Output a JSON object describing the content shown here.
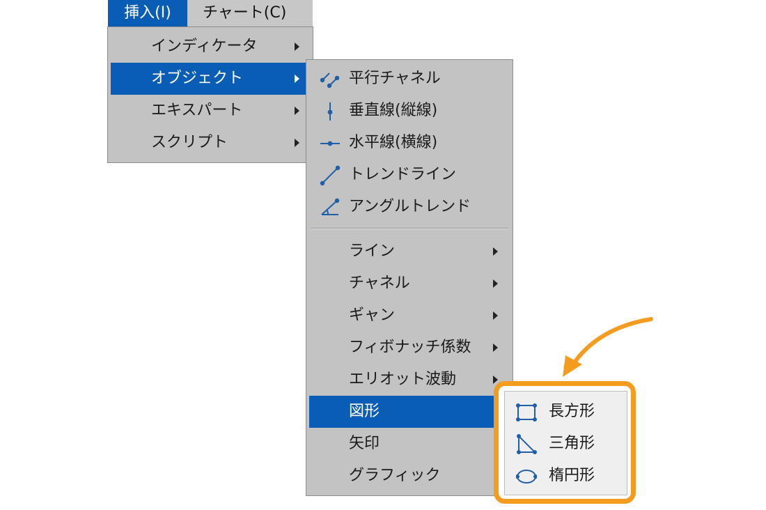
{
  "menubar": {
    "insert": "挿入(I)",
    "chart": "チャート(C)"
  },
  "insert_menu": {
    "items": [
      {
        "label": "インディケータ",
        "has_submenu": true,
        "selected": false
      },
      {
        "label": "オブジェクト",
        "has_submenu": true,
        "selected": true
      },
      {
        "label": "エキスパート",
        "has_submenu": true,
        "selected": false
      },
      {
        "label": "スクリプト",
        "has_submenu": true,
        "selected": false
      }
    ]
  },
  "object_menu": {
    "items": [
      {
        "label": "平行チャネル",
        "icon": "parallel-channel-icon"
      },
      {
        "label": "垂直線(縦線)",
        "icon": "vertical-line-icon"
      },
      {
        "label": "水平線(横線)",
        "icon": "horizontal-line-icon"
      },
      {
        "label": "トレンドライン",
        "icon": "trendline-icon"
      },
      {
        "label": "アングルトレンド",
        "icon": "angle-trend-icon"
      },
      {
        "label": "ライン",
        "has_submenu": true
      },
      {
        "label": "チャネル",
        "has_submenu": true
      },
      {
        "label": "ギャン",
        "has_submenu": true
      },
      {
        "label": "フィボナッチ係数",
        "has_submenu": true
      },
      {
        "label": "エリオット波動",
        "has_submenu": true
      },
      {
        "label": "図形",
        "has_submenu": true,
        "selected": true
      },
      {
        "label": "矢印"
      },
      {
        "label": "グラフィック"
      }
    ]
  },
  "shapes_menu": {
    "items": [
      {
        "label": "長方形",
        "icon": "rectangle-icon"
      },
      {
        "label": "三角形",
        "icon": "triangle-icon"
      },
      {
        "label": "楕円形",
        "icon": "ellipse-icon"
      }
    ]
  },
  "colors": {
    "selection": "#0a5db4",
    "menu_bg": "#c3c3c3",
    "icon": "#1f5fa8",
    "highlight": "#f39c1f"
  }
}
